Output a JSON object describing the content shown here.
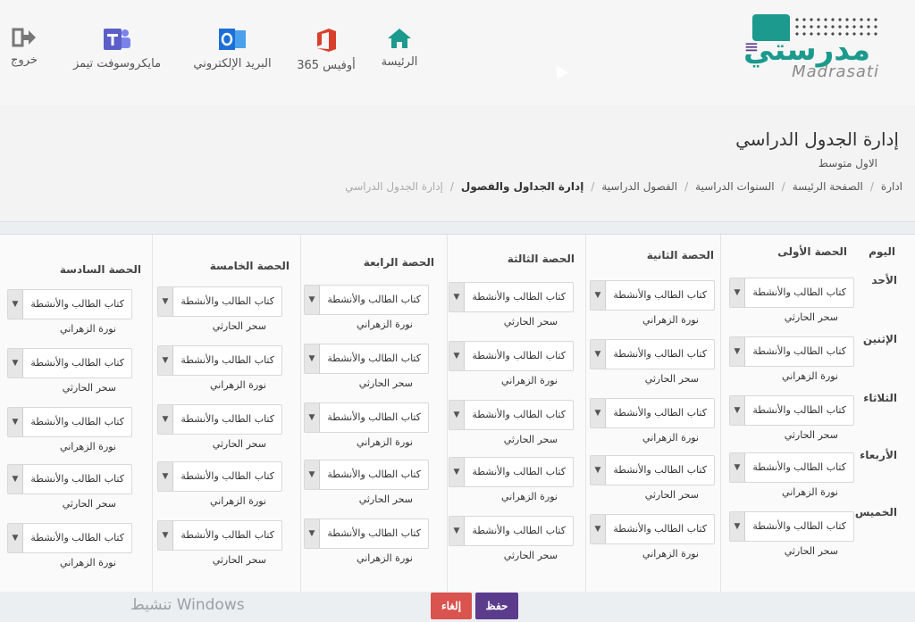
{
  "header": {
    "logo_ar": "مدرستي",
    "logo_en": "Madrasati",
    "menu_icon": "hamburger-icon",
    "nav": [
      {
        "label": "الرئيسة",
        "icon": "home-icon",
        "color": "#1b9a8d"
      },
      {
        "label": "أوفيس 365",
        "icon": "office-icon",
        "color": "#d9402b"
      },
      {
        "label": "البريد الإلكتروني",
        "icon": "outlook-icon",
        "color": "#1d6fd6"
      },
      {
        "label": "مايكروسوفت تيمز",
        "icon": "teams-icon",
        "color": "#5b5fc7"
      },
      {
        "label": "خروج",
        "icon": "logout-icon",
        "color": "#777777"
      }
    ]
  },
  "page": {
    "title": "إدارة الجدول الدراسي",
    "level": "الاول متوسط",
    "breadcrumb": [
      "ادارة",
      "الصفحة الرئيسة",
      "السنوات الدراسية",
      "الفصول الدراسية",
      "إدارة الجداول والفصول",
      "إدارة الجدول الدراسي"
    ]
  },
  "table": {
    "day_header": "اليوم",
    "periods": [
      "الحصة الأولى",
      "الحصة الثانية",
      "الحصة الثالثة",
      "الحصة الرابعة",
      "الحصة الخامسة",
      "الحصة السادسة"
    ],
    "days": [
      "الأحد",
      "الإثنين",
      "الثلاثاء",
      "الأربعاء",
      "الخميس"
    ],
    "rows": [
      {
        "cells": [
          {
            "subject": "كتاب الطالب والأنشطة",
            "teacher": "سحر الحارثي"
          },
          {
            "subject": "كتاب الطالب والأنشطة",
            "teacher": "نورة الزهراني"
          },
          {
            "subject": "كتاب الطالب والأنشطة",
            "teacher": "سحر الحارثي"
          },
          {
            "subject": "كتاب الطالب والأنشطة",
            "teacher": "نورة الزهراني"
          },
          {
            "subject": "كتاب الطالب والأنشطة",
            "teacher": "سحر الحارثي"
          },
          {
            "subject": "كتاب الطالب والأنشطة",
            "teacher": "نورة الزهراني"
          }
        ]
      },
      {
        "cells": [
          {
            "subject": "كتاب الطالب والأنشطة",
            "teacher": "نورة الزهراني"
          },
          {
            "subject": "كتاب الطالب والأنشطة",
            "teacher": "سحر الحارثي"
          },
          {
            "subject": "كتاب الطالب والأنشطة",
            "teacher": "نورة الزهراني"
          },
          {
            "subject": "كتاب الطالب والأنشطة",
            "teacher": "سحر الحارثي"
          },
          {
            "subject": "كتاب الطالب والأنشطة",
            "teacher": "نورة الزهراني"
          },
          {
            "subject": "كتاب الطالب والأنشطة",
            "teacher": "سحر الحارثي"
          }
        ]
      },
      {
        "cells": [
          {
            "subject": "كتاب الطالب والأنشطة",
            "teacher": "سحر الحارثي"
          },
          {
            "subject": "كتاب الطالب والأنشطة",
            "teacher": "نورة الزهراني"
          },
          {
            "subject": "كتاب الطالب والأنشطة",
            "teacher": "سحر الحارثي"
          },
          {
            "subject": "كتاب الطالب والأنشطة",
            "teacher": "نورة الزهراني"
          },
          {
            "subject": "كتاب الطالب والأنشطة",
            "teacher": "سحر الحارثي"
          },
          {
            "subject": "كتاب الطالب والأنشطة",
            "teacher": "نورة الزهراني"
          }
        ]
      },
      {
        "cells": [
          {
            "subject": "كتاب الطالب والأنشطة",
            "teacher": "نورة الزهراني"
          },
          {
            "subject": "كتاب الطالب والأنشطة",
            "teacher": "سحر الحارثي"
          },
          {
            "subject": "كتاب الطالب والأنشطة",
            "teacher": "نورة الزهراني"
          },
          {
            "subject": "كتاب الطالب والأنشطة",
            "teacher": "سحر الحارثي"
          },
          {
            "subject": "كتاب الطالب والأنشطة",
            "teacher": "نورة الزهراني"
          },
          {
            "subject": "كتاب الطالب والأنشطة",
            "teacher": "سحر الحارثي"
          }
        ]
      },
      {
        "cells": [
          {
            "subject": "كتاب الطالب والأنشطة",
            "teacher": "سحر الحارثي"
          },
          {
            "subject": "كتاب الطالب والأنشطة",
            "teacher": "نورة الزهراني"
          },
          {
            "subject": "كتاب الطالب والأنشطة",
            "teacher": "سحر الحارثي"
          },
          {
            "subject": "كتاب الطالب والأنشطة",
            "teacher": "نورة الزهراني"
          },
          {
            "subject": "كتاب الطالب والأنشطة",
            "teacher": "سحر الحارثي"
          },
          {
            "subject": "كتاب الطالب والأنشطة",
            "teacher": "نورة الزهراني"
          }
        ]
      }
    ]
  },
  "actions": {
    "save": "حفظ",
    "cancel": "إلغاء"
  },
  "watermark": "تنشيط Windows",
  "colors": {
    "brand": "#1b9a8d",
    "primary": "#5b3b8c",
    "danger": "#d9534f"
  }
}
